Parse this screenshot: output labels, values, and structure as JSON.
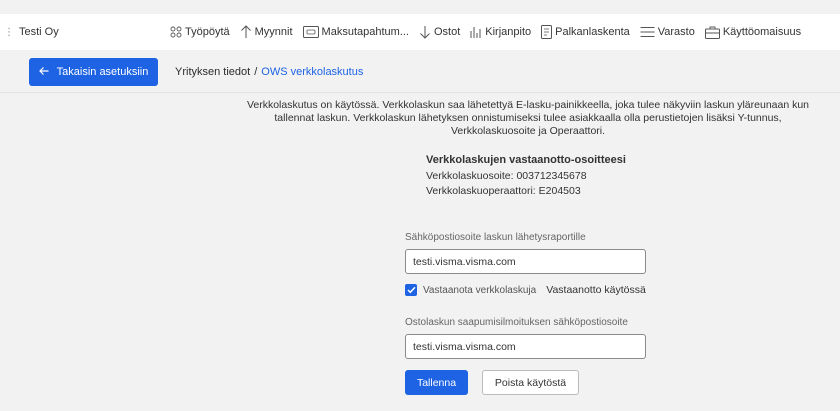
{
  "header": {
    "company": "Testi Oy",
    "nav": [
      {
        "label": "Työpöytä",
        "icon": "dashboard-icon"
      },
      {
        "label": "Myynnit",
        "icon": "arrow-up-icon"
      },
      {
        "label": "Maksutapahtum...",
        "icon": "payment-icon"
      },
      {
        "label": "Ostot",
        "icon": "arrow-down-icon"
      },
      {
        "label": "Kirjanpito",
        "icon": "ledger-icon"
      },
      {
        "label": "Palkanlaskenta",
        "icon": "document-icon"
      },
      {
        "label": "Varasto",
        "icon": "stack-icon"
      },
      {
        "label": "Käyttöomaisuus",
        "icon": "briefcase-icon"
      }
    ]
  },
  "subbar": {
    "back_label": "Takaisin asetuksiin",
    "breadcrumb_parent": "Yrityksen tiedot",
    "breadcrumb_separator": "/",
    "breadcrumb_current": "OWS verkkolaskutus"
  },
  "info": {
    "line1": "Verkkolaskutus on käytössä. Verkkolaskun saa lähetettyä E-lasku-painikkeella, joka tulee näkyviin laskun yläreunaan kun",
    "line2": "tallennat laskun. Verkkolaskun lähetyksen onnistumiseksi tulee asiakkaalla olla perustietojen lisäksi Y-tunnus,",
    "line3": "Verkkolaskuosoite ja Operaattori."
  },
  "addresses": {
    "heading": "Verkkolaskujen vastaanotto-osoitteesi",
    "address": "Verkkolaskuosoite: 003712345678",
    "operator": "Verkkolaskuoperaattori: E204503"
  },
  "form": {
    "report_email_label": "Sähköpostiosoite laskun lähetysraportille",
    "report_email_value": "testi.visma.visma.com",
    "receive_label": "Vastaanota verkkolaskuja",
    "receive_status": "Vastaanotto käytössä",
    "purchase_email_label": "Ostolaskun saapumisilmoituksen sähköpostiosoite",
    "purchase_email_value": "testi.visma.visma.com",
    "save_label": "Tallenna",
    "disable_label": "Poista käytöstä"
  },
  "colors": {
    "accent": "#1d63e4",
    "background": "#f2f2f2"
  }
}
